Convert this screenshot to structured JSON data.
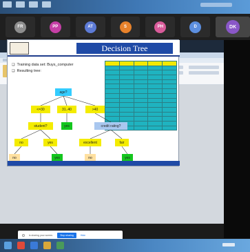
{
  "participants": [
    {
      "initials": "FR",
      "color": "#8e8e8e",
      "active": false
    },
    {
      "initials": "PP",
      "color": "#c53fa6",
      "active": false
    },
    {
      "initials": "AT",
      "color": "#5d7bd6",
      "active": false
    },
    {
      "initials": "S",
      "color": "#e8822b",
      "active": false
    },
    {
      "initials": "PH",
      "color": "#d85b9a",
      "active": false
    },
    {
      "initials": "D",
      "color": "#5c8fe0",
      "active": false
    },
    {
      "initials": "DK",
      "color": "#8a57c8",
      "active": true
    }
  ],
  "slide": {
    "title": "Decision Tree",
    "bullets": [
      "Training data set: Buys_computer",
      "Resulting tree:"
    ],
    "tree": {
      "root": "age?",
      "branches": [
        "<=30",
        "31..40",
        ">40"
      ],
      "student_node": "student?",
      "credit_node": "credit rating?",
      "student_answers": [
        "no",
        "yes"
      ],
      "credit_answers": [
        "excellent",
        "fair"
      ],
      "middle_leaf": "yes",
      "student_leaves": [
        "no",
        "yes"
      ],
      "credit_leaves": [
        "no",
        "yes"
      ]
    }
  },
  "share_bar": {
    "message": "is sharing your screen.",
    "stop_label": "Stop sharing",
    "hide_label": "Hide"
  },
  "colors": {
    "title_blue": "#1f4aa6",
    "question_node": "#33ccff",
    "branch_node": "#f4ec00",
    "yes_leaf": "#14c61e",
    "no_leaf": "#ffe0a0",
    "table_cell": "#1fb3c0"
  }
}
